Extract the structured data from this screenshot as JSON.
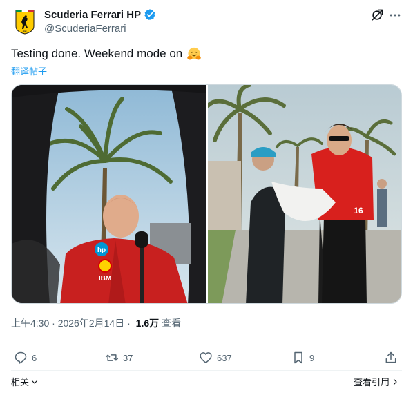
{
  "author": {
    "display_name": "Scuderia Ferrari HP",
    "handle": "@ScuderiaFerrari",
    "verified": true,
    "avatar_icon": "ferrari-prancing-horse-icon",
    "brand_color": "#ffcc00",
    "verified_color": "#1d9bf0"
  },
  "header_icons": [
    "grok-icon",
    "more-icon"
  ],
  "tweet": {
    "text": "Testing done. Weekend mode on",
    "emoji": "hugging-face-emoji",
    "translate_label": "翻译帖子"
  },
  "media": {
    "count": 2
  },
  "meta": {
    "time": "上午4:30",
    "separator": " · ",
    "date": "2026年2月14日",
    "separator2": " · ",
    "views_count": "1.6万",
    "views_label": "查看"
  },
  "actions": {
    "replies": "6",
    "retweets": "37",
    "likes": "637",
    "bookmarks": "9"
  },
  "footer": {
    "related_label": "相关",
    "view_quotes_label": "查看引用"
  },
  "colors": {
    "secondary_text": "#536471",
    "link": "#1d9bf0",
    "ferrari_red": "#d40000"
  }
}
